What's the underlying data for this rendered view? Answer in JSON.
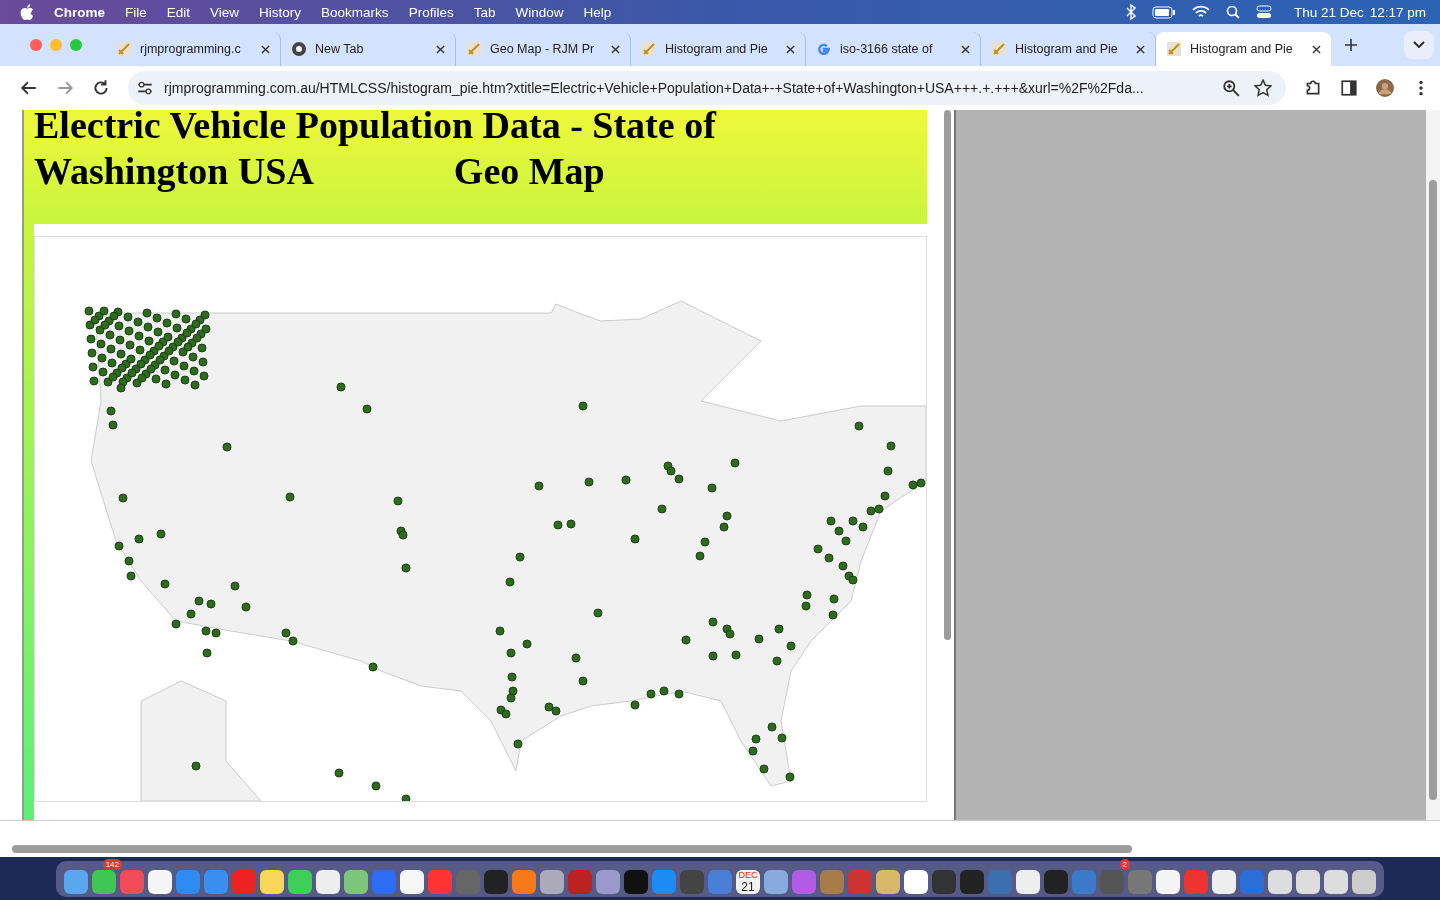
{
  "menu_bar": {
    "app": "Chrome",
    "menus": [
      "File",
      "Edit",
      "View",
      "History",
      "Bookmarks",
      "Profiles",
      "Tab",
      "Window",
      "Help"
    ],
    "date": "Thu 21 Dec",
    "time": "12:17 pm"
  },
  "tabs": [
    {
      "title": "rjmprogramming.c",
      "kind": "site",
      "selected": false
    },
    {
      "title": "New Tab",
      "kind": "chrome",
      "selected": false
    },
    {
      "title": "Geo Map - RJM Pr",
      "kind": "site",
      "selected": false
    },
    {
      "title": "Histogram and Pie",
      "kind": "site",
      "selected": false
    },
    {
      "title": "iso-3166 state of",
      "kind": "google",
      "selected": false
    },
    {
      "title": "Histogram and Pie",
      "kind": "site",
      "selected": false
    },
    {
      "title": "Histogram and Pie",
      "kind": "site",
      "selected": true
    }
  ],
  "address_bar": {
    "url": "rjmprogramming.com.au/HTMLCSS/histogram_pie.htm?xtitle=Electric+Vehicle+Population+Data+-+State+of+Washington+USA+++.+.+++&xurl=%2F%2Fda..."
  },
  "page": {
    "title": "Electric Vehicle Population Data - State of Washington USA",
    "subtitle": "Geo Map"
  },
  "dock": {
    "messages_badge": "142",
    "settings_badge": "2",
    "calendar_month": "DEC",
    "calendar_day": "21"
  }
}
